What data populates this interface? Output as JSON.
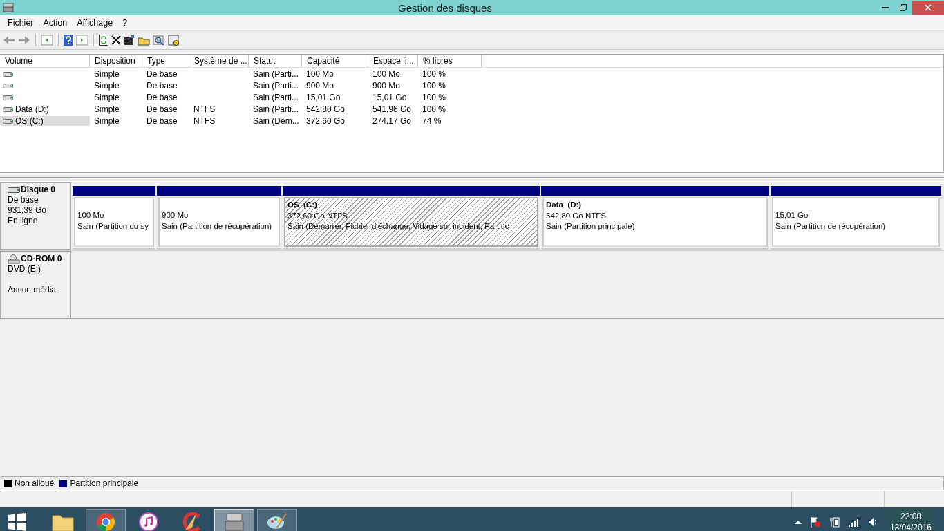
{
  "window": {
    "title": "Gestion des disques"
  },
  "menu": [
    "Fichier",
    "Action",
    "Affichage",
    "?"
  ],
  "table": {
    "columns": [
      "Volume",
      "Disposition",
      "Type",
      "Système de ...",
      "Statut",
      "Capacité",
      "Espace li...",
      "% libres"
    ],
    "rows": [
      {
        "cells": [
          "",
          "Simple",
          "De base",
          "",
          "Sain (Parti...",
          "100 Mo",
          "100 Mo",
          "100 %"
        ],
        "selected": false
      },
      {
        "cells": [
          "",
          "Simple",
          "De base",
          "",
          "Sain (Parti...",
          "900 Mo",
          "900 Mo",
          "100 %"
        ],
        "selected": false
      },
      {
        "cells": [
          "",
          "Simple",
          "De base",
          "",
          "Sain (Parti...",
          "15,01 Go",
          "15,01 Go",
          "100 %"
        ],
        "selected": false
      },
      {
        "cells": [
          "Data (D:)",
          "Simple",
          "De base",
          "NTFS",
          "Sain (Parti...",
          "542,80 Go",
          "541,96 Go",
          "100 %"
        ],
        "selected": false
      },
      {
        "cells": [
          "OS (C:)",
          "Simple",
          "De base",
          "NTFS",
          "Sain (Dém...",
          "372,60 Go",
          "274,17 Go",
          "74 %"
        ],
        "selected": true
      }
    ]
  },
  "disks": [
    {
      "kind": "disk",
      "name": "Disque 0",
      "lines": [
        "De base",
        "931,39 Go",
        "En ligne"
      ],
      "partitions": [
        {
          "size": "100 Mo",
          "status": "Sain (Partition du sy",
          "selected": false
        },
        {
          "size": "900 Mo",
          "status": "Sain (Partition de récupération)",
          "selected": false
        },
        {
          "name": "OS  (C:)",
          "size": "372,60 Go NTFS",
          "status": "Sain (Démarrer, Fichier d'échange, Vidage sur incident, Partitic",
          "selected": true
        },
        {
          "name": "Data  (D:)",
          "size": "542,80 Go NTFS",
          "status": "Sain (Partition principale)",
          "selected": false
        },
        {
          "size": "15,01 Go",
          "status": "Sain (Partition de récupération)",
          "selected": false
        }
      ]
    },
    {
      "kind": "cdrom",
      "name": "CD-ROM 0",
      "lines": [
        "DVD (E:)"
      ],
      "media": "Aucun média"
    }
  ],
  "legend": [
    {
      "label": "Non alloué",
      "color": "#000000"
    },
    {
      "label": "Partition principale",
      "color": "#000080"
    }
  ],
  "taskbar": {
    "apps": [
      {
        "kind": "folder",
        "open": false,
        "selected": false
      },
      {
        "kind": "chrome",
        "open": true,
        "selected": false
      },
      {
        "kind": "music",
        "open": false,
        "selected": false
      },
      {
        "kind": "cleaner",
        "open": false,
        "selected": false
      },
      {
        "kind": "disk",
        "open": true,
        "selected": true
      },
      {
        "kind": "paint",
        "open": true,
        "selected": false
      }
    ],
    "time": "22:08",
    "date": "13/04/2016"
  }
}
